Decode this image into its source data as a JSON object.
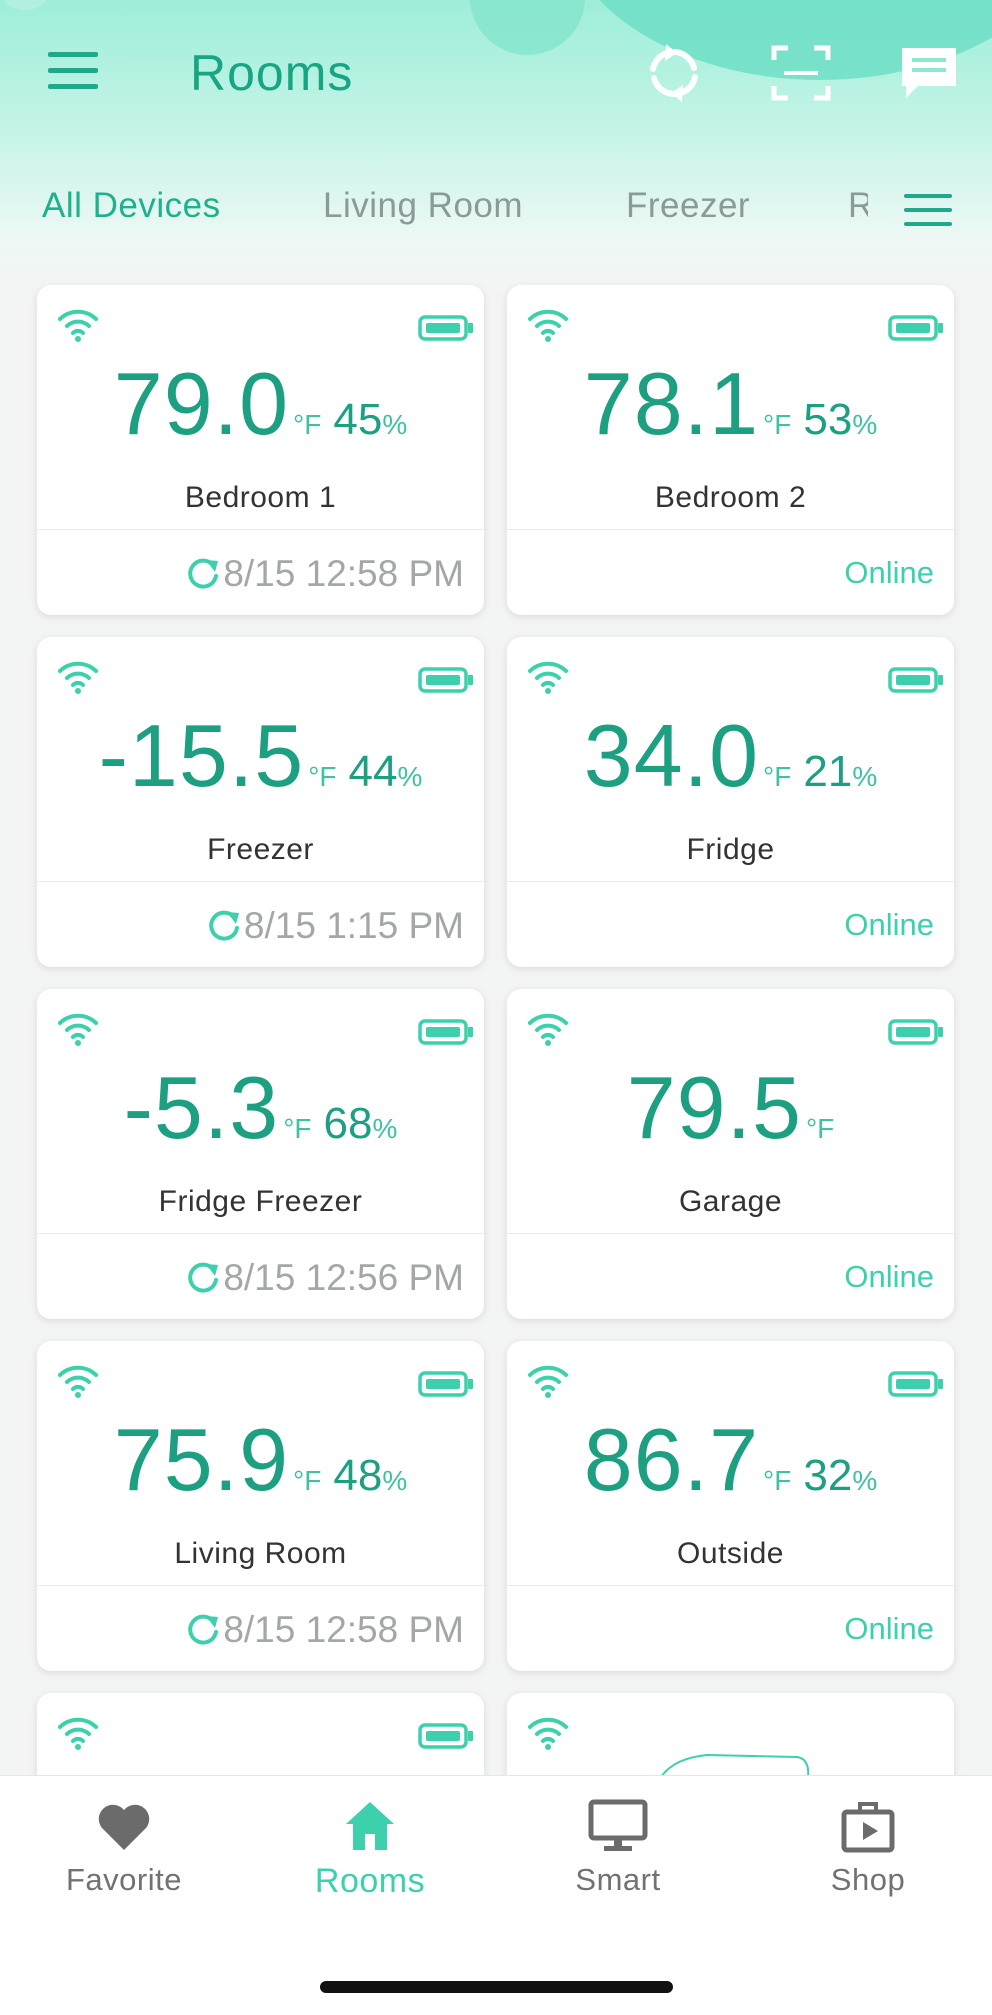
{
  "header": {
    "title": "Rooms",
    "icons": [
      "menu-icon",
      "sync-icon",
      "scan-icon",
      "message-icon"
    ]
  },
  "tabs": [
    {
      "label": "All Devices",
      "active": true
    },
    {
      "label": "Living Room",
      "active": false
    },
    {
      "label": "Freezer",
      "active": false
    },
    {
      "label": "R",
      "active": false
    }
  ],
  "devices": [
    {
      "name": "Bedroom 1",
      "temp": "79.0",
      "unit": "°F",
      "humidity": "45",
      "pct": "%",
      "updated": "8/15 12:58 PM",
      "status": ""
    },
    {
      "name": "Bedroom 2",
      "temp": "78.1",
      "unit": "°F",
      "humidity": "53",
      "pct": "%",
      "updated": "",
      "status": "Online"
    },
    {
      "name": "Freezer",
      "temp": "-15.5",
      "unit": "°F",
      "humidity": "44",
      "pct": "%",
      "updated": "8/15 1:15 PM",
      "status": ""
    },
    {
      "name": "Fridge",
      "temp": "34.0",
      "unit": "°F",
      "humidity": "21",
      "pct": "%",
      "updated": "",
      "status": "Online"
    },
    {
      "name": "Fridge Freezer",
      "temp": "-5.3",
      "unit": "°F",
      "humidity": "68",
      "pct": "%",
      "updated": "8/15 12:56 PM",
      "status": ""
    },
    {
      "name": "Garage",
      "temp": "79.5",
      "unit": "°F",
      "humidity": "",
      "pct": "",
      "updated": "",
      "status": "Online"
    },
    {
      "name": "Living Room",
      "temp": "75.9",
      "unit": "°F",
      "humidity": "48",
      "pct": "%",
      "updated": "8/15 12:58 PM",
      "status": ""
    },
    {
      "name": "Outside",
      "temp": "86.7",
      "unit": "°F",
      "humidity": "32",
      "pct": "%",
      "updated": "",
      "status": "Online"
    }
  ],
  "bottom_nav": [
    {
      "label": "Favorite",
      "icon": "heart-icon",
      "active": false
    },
    {
      "label": "Rooms",
      "icon": "home-icon",
      "active": true
    },
    {
      "label": "Smart",
      "icon": "monitor-icon",
      "active": false
    },
    {
      "label": "Shop",
      "icon": "shopping-bag-icon",
      "active": false
    }
  ],
  "colors": {
    "accent": "#1fb08d",
    "accent_light": "#3cd0ad",
    "header_gradient_top": "#9eeed9",
    "background": "#f3f4f4",
    "muted_text": "#a3a7a6"
  }
}
